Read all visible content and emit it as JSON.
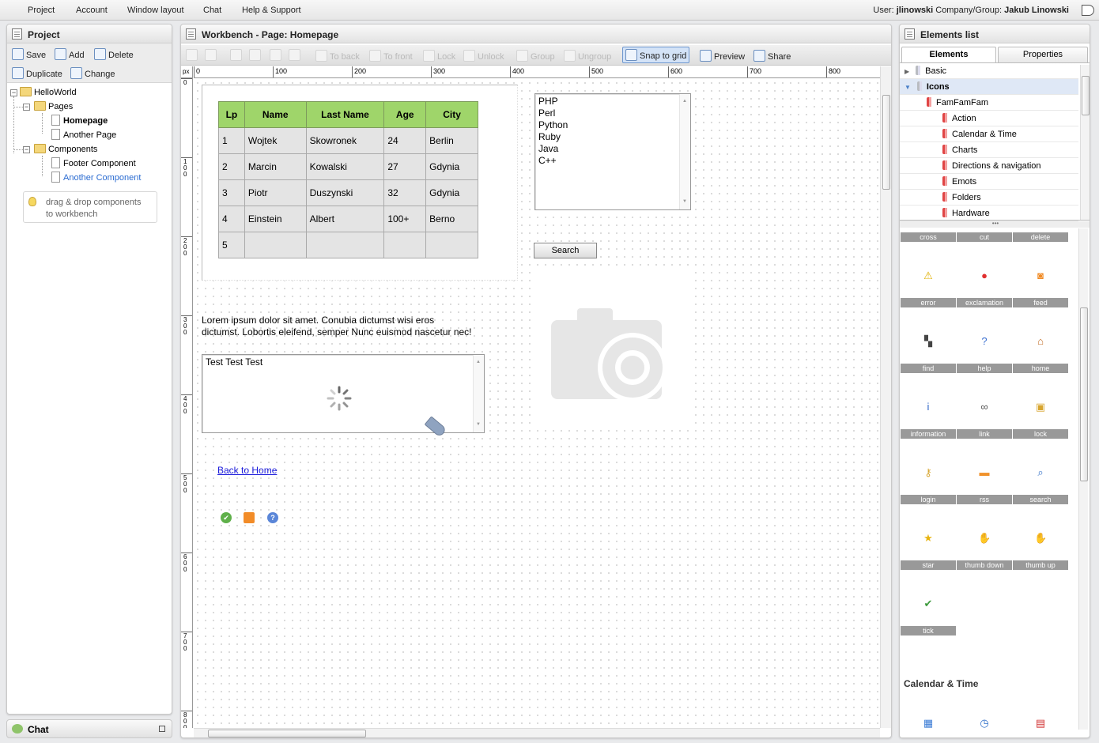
{
  "menubar": {
    "items": [
      "Project",
      "Account",
      "Window layout",
      "Chat",
      "Help & Support"
    ],
    "user_label": "User:",
    "user_name": "jlinowski",
    "company_label": "Company/Group:",
    "company_name": "Jakub Linowski"
  },
  "project_panel": {
    "title": "Project",
    "buttons": {
      "save": "Save",
      "add": "Add",
      "delete": "Delete",
      "duplicate": "Duplicate",
      "change": "Change"
    },
    "tree": {
      "root": "HelloWorld",
      "pages_folder": "Pages",
      "pages": [
        "Homepage",
        "Another Page"
      ],
      "components_folder": "Components",
      "components": [
        "Footer Component",
        "Another Component"
      ]
    },
    "hint": [
      "drag & drop components",
      "to workbench"
    ]
  },
  "chat": {
    "label": "Chat"
  },
  "workbench": {
    "title": "Workbench - Page: Homepage",
    "toolbar": {
      "to_back": "To back",
      "to_front": "To front",
      "lock": "Lock",
      "unlock": "Unlock",
      "group": "Group",
      "ungroup": "Ungroup",
      "snap": "Snap to grid",
      "preview": "Preview",
      "share": "Share"
    },
    "ruler_unit": "px",
    "ruler_top": [
      "0",
      "100",
      "200",
      "300",
      "400",
      "500",
      "600",
      "700",
      "800"
    ],
    "ruler_left": [
      "0",
      "100",
      "200",
      "300",
      "400",
      "500",
      "600",
      "700",
      "800"
    ],
    "table": {
      "headers": [
        "Lp",
        "Name",
        "Last Name",
        "Age",
        "City"
      ],
      "rows": [
        [
          "1",
          "Wojtek",
          "Skowronek",
          "24",
          "Berlin"
        ],
        [
          "2",
          "Marcin",
          "Kowalski",
          "27",
          "Gdynia"
        ],
        [
          "3",
          "Piotr",
          "Duszynski",
          "32",
          "Gdynia"
        ],
        [
          "4",
          "Einstein",
          "Albert",
          "100+",
          "Berno"
        ],
        [
          "5",
          "",
          "",
          "",
          ""
        ]
      ]
    },
    "listbox": [
      "PHP",
      "Perl",
      "Python",
      "Ruby",
      "Java",
      "C++"
    ],
    "search_button": "Search",
    "lorem_line1": "Lorem ipsum dolor sit amet. Conubia dictumst wisi eros",
    "lorem_line2": "dictumst. Lobortis eleifend, semper Nunc euismod nascetur nec!",
    "textarea_value": "Test Test Test",
    "link": "Back to Home"
  },
  "elements_panel": {
    "title": "Elements list",
    "tabs": [
      "Elements",
      "Properties"
    ],
    "tree": {
      "basic": "Basic",
      "icons": "Icons",
      "famfamfam": "FamFamFam",
      "categories": [
        "Action",
        "Calendar & Time",
        "Charts",
        "Directions & navigation",
        "Emots",
        "Folders",
        "Hardware"
      ]
    },
    "grid_top_labels": [
      "cross",
      "cut",
      "delete"
    ],
    "icons": [
      {
        "label": "error",
        "icon": "warning-icon",
        "glyph": "⚠",
        "color": "#e0b000"
      },
      {
        "label": "exclamation",
        "icon": "exclamation-icon",
        "glyph": "●",
        "color": "#e03030"
      },
      {
        "label": "feed",
        "icon": "feed-icon",
        "glyph": "◙",
        "color": "#f08a24"
      },
      {
        "label": "find",
        "icon": "binoculars-icon",
        "glyph": "▚",
        "color": "#444"
      },
      {
        "label": "help",
        "icon": "help-icon",
        "glyph": "?",
        "color": "#3a6fd0"
      },
      {
        "label": "home",
        "icon": "home-icon",
        "glyph": "⌂",
        "color": "#c06a20"
      },
      {
        "label": "information",
        "icon": "information-icon",
        "glyph": "i",
        "color": "#2f66c8"
      },
      {
        "label": "link",
        "icon": "link-icon",
        "glyph": "∞",
        "color": "#555"
      },
      {
        "label": "lock",
        "icon": "lock-icon",
        "glyph": "▣",
        "color": "#d7a530"
      },
      {
        "label": "login",
        "icon": "key-icon",
        "glyph": "⚷",
        "color": "#d7a530"
      },
      {
        "label": "rss",
        "icon": "rss-icon",
        "glyph": "▬",
        "color": "#f0922b"
      },
      {
        "label": "search",
        "icon": "magnifier-icon",
        "glyph": "⌕",
        "color": "#3c77c9"
      },
      {
        "label": "star",
        "icon": "star-icon",
        "glyph": "★",
        "color": "#e8b410"
      },
      {
        "label": "thumb down",
        "icon": "thumb-down-icon",
        "glyph": "✋",
        "color": "#e49595"
      },
      {
        "label": "thumb up",
        "icon": "thumb-up-icon",
        "glyph": "✋",
        "color": "#e49595"
      },
      {
        "label": "tick",
        "icon": "tick-icon",
        "glyph": "✔",
        "color": "#3c9a3c"
      }
    ],
    "section2": "Calendar & Time",
    "icons2": [
      {
        "label": "calendar",
        "icon": "calendar-icon",
        "glyph": "▦",
        "color": "#3a7bd5"
      },
      {
        "label": "clock",
        "icon": "clock-icon",
        "glyph": "◷",
        "color": "#2f6fc8"
      },
      {
        "label": "date",
        "icon": "date-icon",
        "glyph": "▤",
        "color": "#d03030"
      }
    ]
  }
}
